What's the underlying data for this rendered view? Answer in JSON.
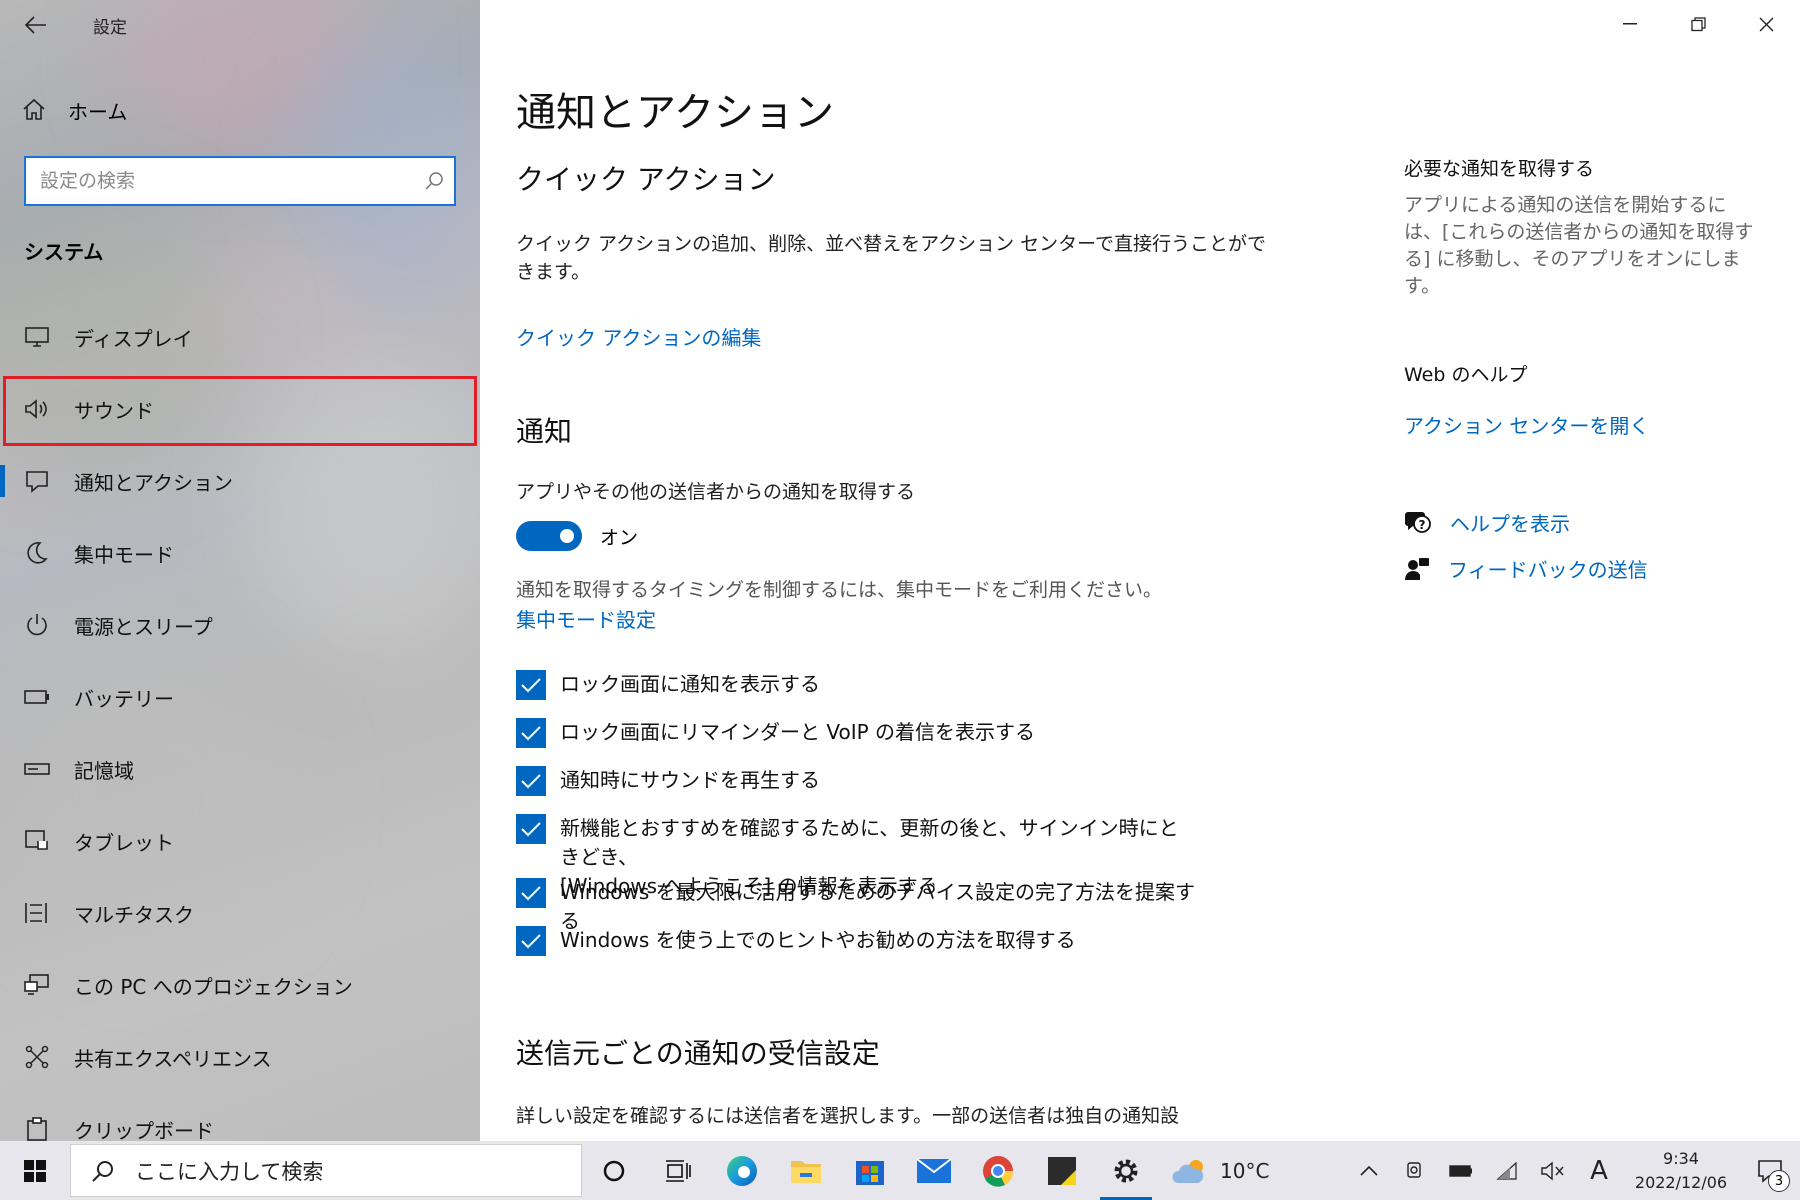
{
  "app": {
    "title": "設定"
  },
  "sidebar": {
    "home_label": "ホーム",
    "search_placeholder": "設定の検索",
    "section_title": "システム",
    "items": [
      {
        "label": "ディスプレイ",
        "icon": "display-icon"
      },
      {
        "label": "サウンド",
        "icon": "speaker-icon",
        "highlighted": true
      },
      {
        "label": "通知とアクション",
        "icon": "notification-icon",
        "active": true
      },
      {
        "label": "集中モード",
        "icon": "moon-icon"
      },
      {
        "label": "電源とスリープ",
        "icon": "power-icon"
      },
      {
        "label": "バッテリー",
        "icon": "battery-icon"
      },
      {
        "label": "記憶域",
        "icon": "storage-icon"
      },
      {
        "label": "タブレット",
        "icon": "tablet-icon"
      },
      {
        "label": "マルチタスク",
        "icon": "multitask-icon"
      },
      {
        "label": "この PC へのプロジェクション",
        "icon": "projection-icon"
      },
      {
        "label": "共有エクスペリエンス",
        "icon": "share-icon"
      },
      {
        "label": "クリップボード",
        "icon": "clipboard-icon"
      }
    ]
  },
  "main": {
    "title": "通知とアクション",
    "quick_actions": {
      "heading": "クイック アクション",
      "desc_line1": "クイック アクションの追加、削除、並べ替えをアクション センターで直接行うことがで",
      "desc_line2": "きます。",
      "edit_link": "クイック アクションの編集"
    },
    "notifications": {
      "heading": "通知",
      "get_label": "アプリやその他の送信者からの通知を取得する",
      "toggle_state": "オン",
      "toggle_on": true,
      "timing_desc": "通知を取得するタイミングを制御するには、集中モードをご利用ください。",
      "focus_link": "集中モード設定",
      "checkboxes": [
        {
          "label": "ロック画面に通知を表示する",
          "checked": true
        },
        {
          "label": "ロック画面にリマインダーと VoIP の着信を表示する",
          "checked": true
        },
        {
          "label": "通知時にサウンドを再生する",
          "checked": true
        },
        {
          "label": "新機能とおすすめを確認するために、更新の後と、サインイン時にときどき、",
          "label2": "[Windows へようこそ] の情報を表示する",
          "checked": true
        },
        {
          "label": "Windows を最大限に活用するためのデバイス設定の完了方法を提案する",
          "checked": true
        },
        {
          "label": "Windows を使う上でのヒントやお勧めの方法を取得する",
          "checked": true
        }
      ]
    },
    "per_sender": {
      "heading": "送信元ごとの通知の受信設定",
      "desc": "詳しい設定を確認するには送信者を選択します。一部の送信者は独自の通知設"
    }
  },
  "right": {
    "get_notif_heading": "必要な通知を取得する",
    "get_notif_desc": "アプリによる通知の送信を開始するには、[これらの送信者からの通知を取得する] に移動し、そのアプリをオンにします。",
    "web_help_heading": "Web のヘルプ",
    "action_center_link": "アクション センターを開く",
    "help_link": "ヘルプを表示",
    "feedback_link": "フィードバックの送信"
  },
  "taskbar": {
    "search_placeholder": "ここに入力して検索",
    "weather": "10°C",
    "ime": "A",
    "time": "9:34",
    "date": "2022/12/06",
    "notif_count": "3"
  },
  "colors": {
    "accent": "#0067c0",
    "highlight": "#e01e28"
  }
}
